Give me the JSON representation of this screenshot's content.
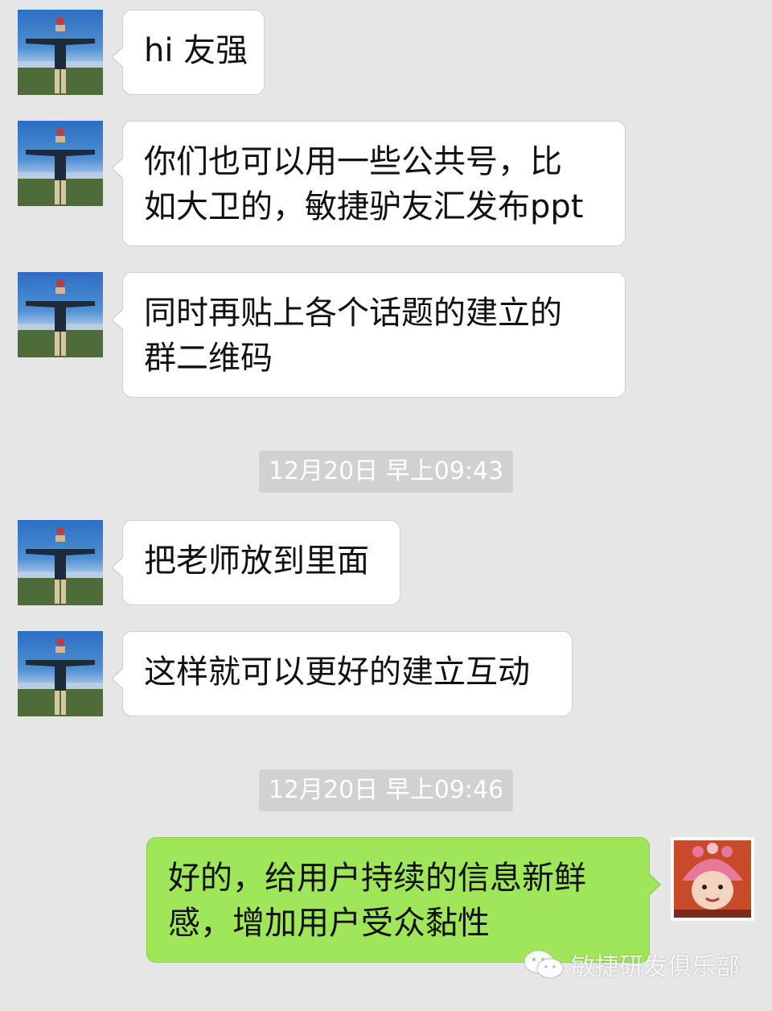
{
  "messages": [
    {
      "side": "left",
      "lines": [
        "hi 友强"
      ]
    },
    {
      "side": "left",
      "lines": [
        "你们也可以用一些公共号，比",
        "如大卫的，敏捷驴友汇发布ppt"
      ]
    },
    {
      "side": "left",
      "lines": [
        "同时再贴上各个话题的建立的",
        "群二维码"
      ]
    },
    {
      "side": "left",
      "lines": [
        "把老师放到里面"
      ]
    },
    {
      "side": "left",
      "lines": [
        "这样就可以更好的建立互动"
      ]
    },
    {
      "side": "right",
      "lines": [
        "好的，给用户持续的信息新鲜",
        "感，增加用户受众黏性"
      ]
    }
  ],
  "timestamps": [
    "12月20日 早上09:43",
    "12月20日 早上09:46"
  ],
  "watermark": {
    "text": "敏捷研发俱乐部",
    "icon": "wechat-icon"
  },
  "icons": {
    "contact_avatar": "contact-avatar-icon",
    "self_avatar": "self-avatar-icon"
  },
  "colors": {
    "background": "#e6e6e6",
    "incoming_bubble": "#ffffff",
    "outgoing_bubble": "#9fe658",
    "timestamp_bg": "#d1d1d1"
  }
}
